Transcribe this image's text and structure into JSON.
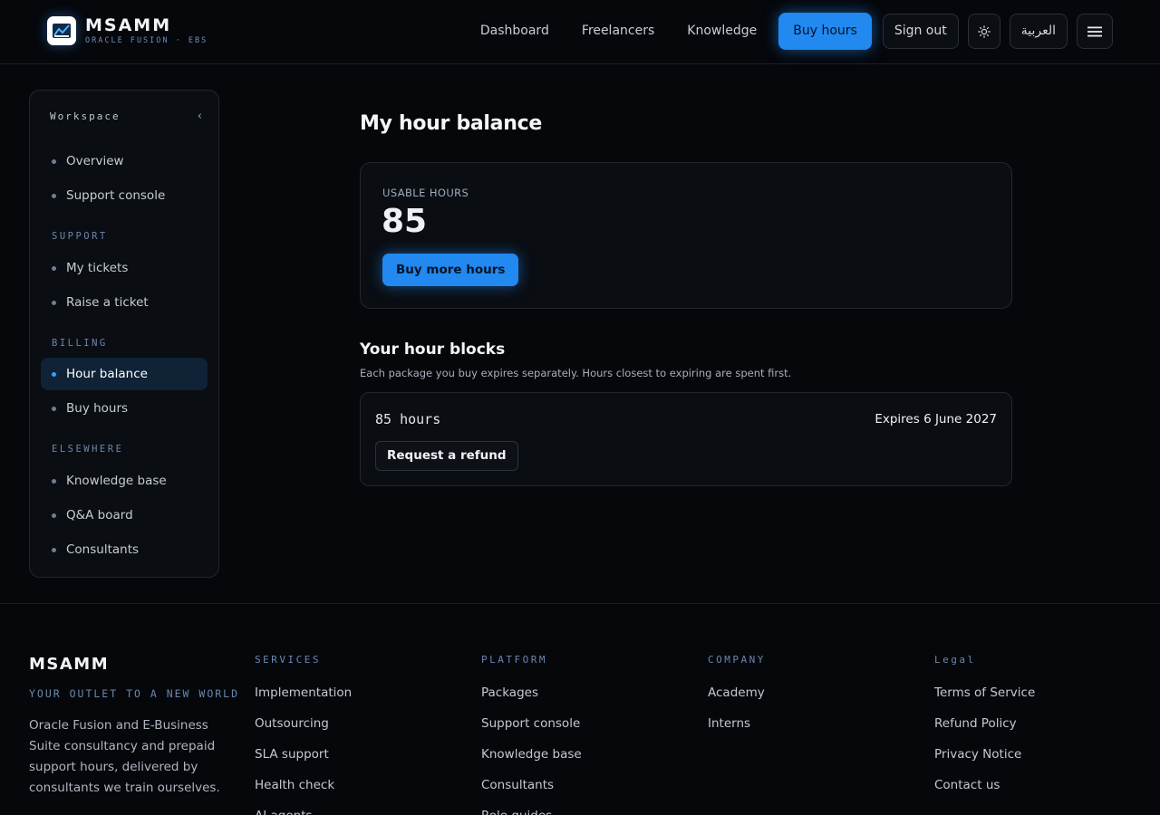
{
  "header": {
    "brand": "MSAMM",
    "brand_sub": "ORACLE FUSION · EBS",
    "nav": [
      "Dashboard",
      "Freelancers",
      "Knowledge"
    ],
    "buy_hours": "Buy hours",
    "sign_out": "Sign out",
    "lang": "العربية"
  },
  "sidebar": {
    "title": "Workspace",
    "collapse_glyph": "‹",
    "top_items": [
      "Overview",
      "Support console"
    ],
    "support_label": "SUPPORT",
    "support_items": [
      "My tickets",
      "Raise a ticket"
    ],
    "billing_label": "BILLING",
    "billing_items": [
      "Hour balance",
      "Buy hours"
    ],
    "elsewhere_label": "ELSEWHERE",
    "elsewhere_items": [
      "Knowledge base",
      "Q&A board",
      "Consultants"
    ],
    "active_item": "Hour balance"
  },
  "main": {
    "title": "My hour balance",
    "usable_label": "USABLE HOURS",
    "usable_value": "85",
    "buy_more": "Buy more hours",
    "blocks_title": "Your hour blocks",
    "blocks_subtitle": "Each package you buy expires separately. Hours closest to expiring are spent first.",
    "blocks": [
      {
        "hours": "85 hours",
        "expiry": "Expires 6 June 2027",
        "refund": "Request a refund"
      }
    ]
  },
  "footer": {
    "brand": "MSAMM",
    "tagline": "YOUR OUTLET TO A NEW WORLD",
    "description": "Oracle Fusion and E-Business Suite consultancy and prepaid support hours, delivered by consultants we train ourselves.",
    "services_label": "SERVICES",
    "services": [
      "Implementation",
      "Outsourcing",
      "SLA support",
      "Health check",
      "AI agents"
    ],
    "platform_label": "PLATFORM",
    "platform": [
      "Packages",
      "Support console",
      "Knowledge base",
      "Consultants",
      "Role guides"
    ],
    "company_label": "COMPANY",
    "company": [
      "Academy",
      "Interns"
    ],
    "legal_label": "Legal",
    "legal": [
      "Terms of Service",
      "Refund Policy",
      "Privacy Notice",
      "Contact us"
    ]
  },
  "colors": {
    "accent": "#2189f0",
    "background": "#05070b",
    "card": "#0a0d12",
    "muted_label": "#6b87ad"
  },
  "icons": {
    "theme_toggle": "sun-icon",
    "menu": "hamburger-menu-icon",
    "collapse": "chevron-left-icon"
  }
}
